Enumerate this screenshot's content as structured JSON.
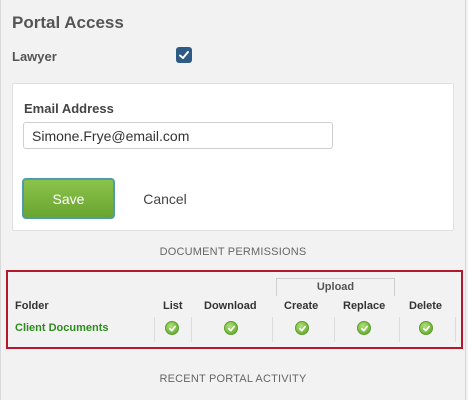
{
  "portal": {
    "title": "Portal Access",
    "lawyer_label": "Lawyer",
    "lawyer_checked": true
  },
  "form": {
    "email_label": "Email Address",
    "email_value": "Simone.Frye@email.com",
    "save_label": "Save",
    "cancel_label": "Cancel"
  },
  "permissions": {
    "heading": "DOCUMENT PERMISSIONS",
    "upload_group_label": "Upload",
    "columns": {
      "folder": "Folder",
      "list": "List",
      "download": "Download",
      "create": "Create",
      "replace": "Replace",
      "delete": "Delete"
    },
    "rows": [
      {
        "folder": "Client Documents",
        "list": true,
        "download": true,
        "create": true,
        "replace": true,
        "delete": true
      }
    ]
  },
  "recent_heading": "RECENT PORTAL ACTIVITY",
  "colors": {
    "save_button": "#7cb342",
    "focus_outline": "#4e9bab",
    "highlight_border": "#b5182a",
    "checkbox": "#2e5b86",
    "folder_link": "#2e8b1f",
    "permission_ok": "#6fb33a"
  }
}
